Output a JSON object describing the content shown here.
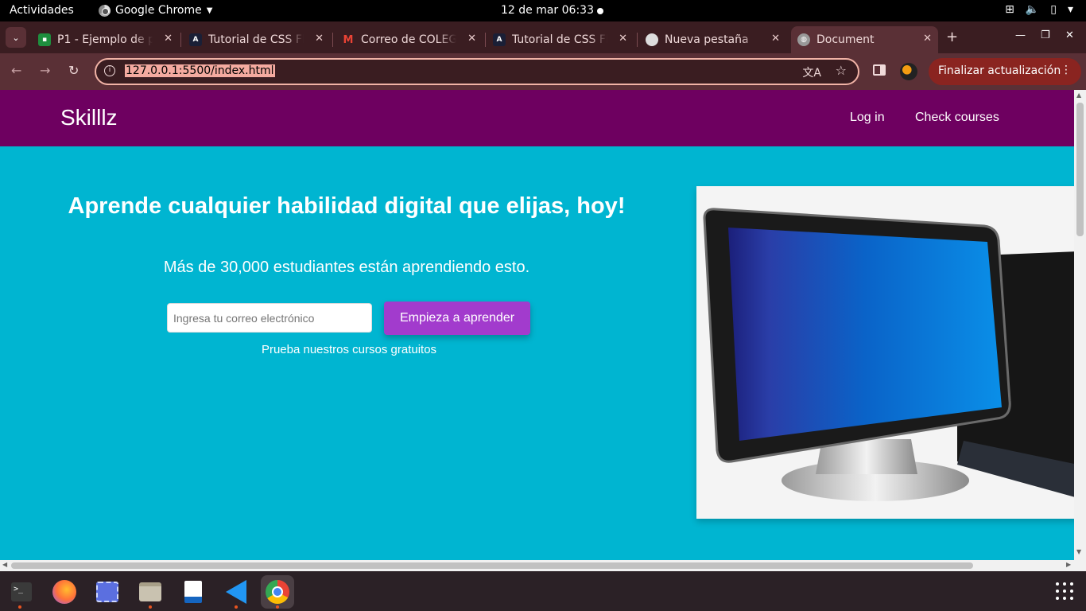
{
  "system": {
    "activities": "Actividades",
    "app_name": "Google Chrome",
    "clock": "12 de mar  06:33"
  },
  "browser": {
    "tabs": [
      {
        "title": "P1 - Ejemplo de pa",
        "icon": "google-classroom-icon",
        "color": "#1e8e3e"
      },
      {
        "title": "Tutorial de CSS Fle",
        "icon": "angular-icon",
        "color": "#1a1f36"
      },
      {
        "title": "Correo de COLEGI",
        "icon": "gmail-icon",
        "color": "#ffffff"
      },
      {
        "title": "Tutorial de CSS Fle",
        "icon": "angular-icon",
        "color": "#1a1f36"
      },
      {
        "title": "Nueva pestaña",
        "icon": "chrome-icon",
        "color": "#dddddd"
      },
      {
        "title": "Document",
        "icon": "globe-icon",
        "color": "#dddddd"
      }
    ],
    "active_tab": 5,
    "url": "127.0.0.1:5500/index.html",
    "update_button": "Finalizar actualización"
  },
  "site": {
    "brand": "Skilllz",
    "nav": [
      "Log in",
      "Check courses"
    ],
    "hero_title": "Aprende cualquier habilidad digital que elijas, hoy!",
    "hero_subtitle": "Más de 30,000 estudiantes están aprendiendo esto.",
    "email_placeholder": "Ingresa tu correo electrónico",
    "cta_label": "Empieza a aprender",
    "free_courses_link": "Prueba nuestros cursos gratuitos",
    "colors": {
      "nav_bg": "#6e0060",
      "hero_bg": "#00b5d1",
      "cta_bg": "#a23bcd"
    }
  },
  "dock": [
    "terminal-icon",
    "firefox-icon",
    "screenshot-icon",
    "files-icon",
    "text-editor-icon",
    "vscode-icon",
    "chrome-icon"
  ]
}
